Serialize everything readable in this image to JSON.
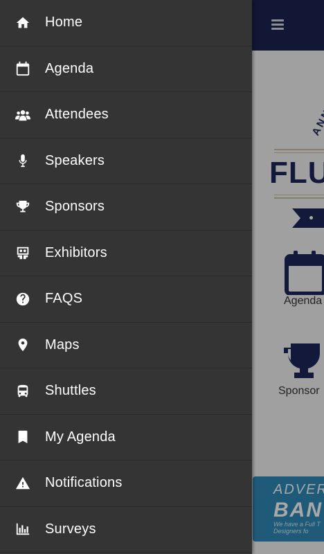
{
  "background": {
    "header_color": "#1c2452",
    "logo_arc_text": "ANN",
    "logo_word": "FLUI",
    "tiles": [
      {
        "label": "Agenda",
        "icon": "calendar-icon"
      },
      {
        "label": "Sponsor",
        "icon": "trophy-icon"
      }
    ],
    "banner": {
      "line1": "ADVER",
      "line2": "BAN",
      "line3": "We have a Full T",
      "line4": "Designers fo"
    }
  },
  "drawer": {
    "items": [
      {
        "label": "Home",
        "icon": "home-icon"
      },
      {
        "label": "Agenda",
        "icon": "calendar-icon"
      },
      {
        "label": "Attendees",
        "icon": "people-icon"
      },
      {
        "label": "Speakers",
        "icon": "microphone-icon"
      },
      {
        "label": "Sponsors",
        "icon": "trophy-icon"
      },
      {
        "label": "Exhibitors",
        "icon": "booth-icon"
      },
      {
        "label": "FAQS",
        "icon": "question-icon"
      },
      {
        "label": "Maps",
        "icon": "map-pin-icon"
      },
      {
        "label": "Shuttles",
        "icon": "bus-icon"
      },
      {
        "label": "My Agenda",
        "icon": "bookmark-icon"
      },
      {
        "label": "Notifications",
        "icon": "warning-icon"
      },
      {
        "label": "Surveys",
        "icon": "bar-chart-icon"
      }
    ]
  }
}
